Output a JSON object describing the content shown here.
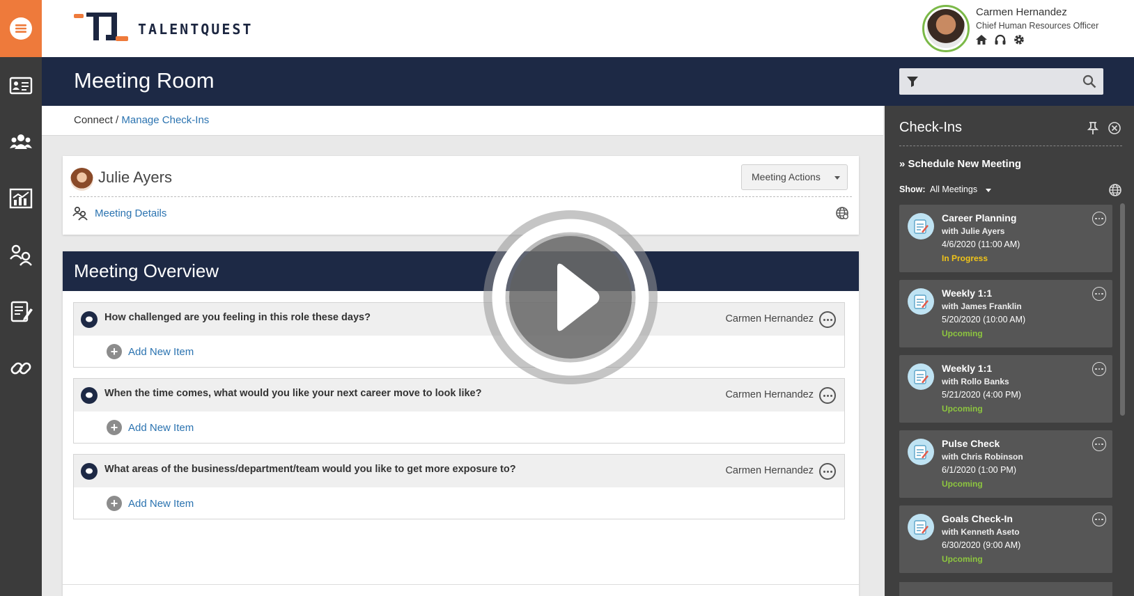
{
  "brand": {
    "name": "TALENTQUEST",
    "accent": "#ee7a3b",
    "navy": "#1d2945",
    "link": "#2b73b0"
  },
  "user": {
    "name": "Carmen Hernandez",
    "role": "Chief Human Resources Officer",
    "icons": [
      "home-icon",
      "headset-icon",
      "gear-icon"
    ]
  },
  "page": {
    "title": "Meeting Room"
  },
  "search": {
    "placeholder": "",
    "value": ""
  },
  "breadcrumb": {
    "root": "Connect",
    "separator": " / ",
    "current": "Manage Check-Ins"
  },
  "rail": {
    "items": [
      "menu-icon",
      "profile-card-icon",
      "team-icon",
      "analytics-icon",
      "connect-icon",
      "notes-icon",
      "link-icon"
    ]
  },
  "meeting": {
    "attendee": "Julie Ayers",
    "actions_label": "Meeting Actions",
    "details_label": "Meeting Details"
  },
  "overview": {
    "title": "Meeting Overview",
    "add_label": "Add New Item",
    "questions": [
      {
        "text": "How challenged are you feeling in this role these days?",
        "owner": "Carmen Hernandez"
      },
      {
        "text": "When the time comes, what would you like your next career move to look like?",
        "owner": "Carmen Hernandez"
      },
      {
        "text": "What areas of the business/department/team would you like to get more exposure to?",
        "owner": "Carmen Hernandez"
      }
    ]
  },
  "panel": {
    "title": "Check-Ins",
    "schedule_label": "» Schedule New Meeting",
    "show_label": "Show:",
    "show_value": "All Meetings",
    "status_colors": {
      "In Progress": "#f0c419",
      "Upcoming": "#8dc63f"
    },
    "meetings": [
      {
        "title": "Career Planning",
        "with": "with Julie Ayers",
        "date": "4/6/2020 (11:00 AM)",
        "status": "In Progress"
      },
      {
        "title": "Weekly 1:1",
        "with": "with James Franklin",
        "date": "5/20/2020 (10:00 AM)",
        "status": "Upcoming"
      },
      {
        "title": "Weekly 1:1",
        "with": "with Rollo Banks",
        "date": "5/21/2020 (4:00 PM)",
        "status": "Upcoming"
      },
      {
        "title": "Pulse Check",
        "with": "with Chris Robinson",
        "date": "6/1/2020 (1:00 PM)",
        "status": "Upcoming"
      },
      {
        "title": "Goals Check-In",
        "with": "with Kenneth Aseto",
        "date": "6/30/2020 (9:00 AM)",
        "status": "Upcoming"
      }
    ]
  }
}
